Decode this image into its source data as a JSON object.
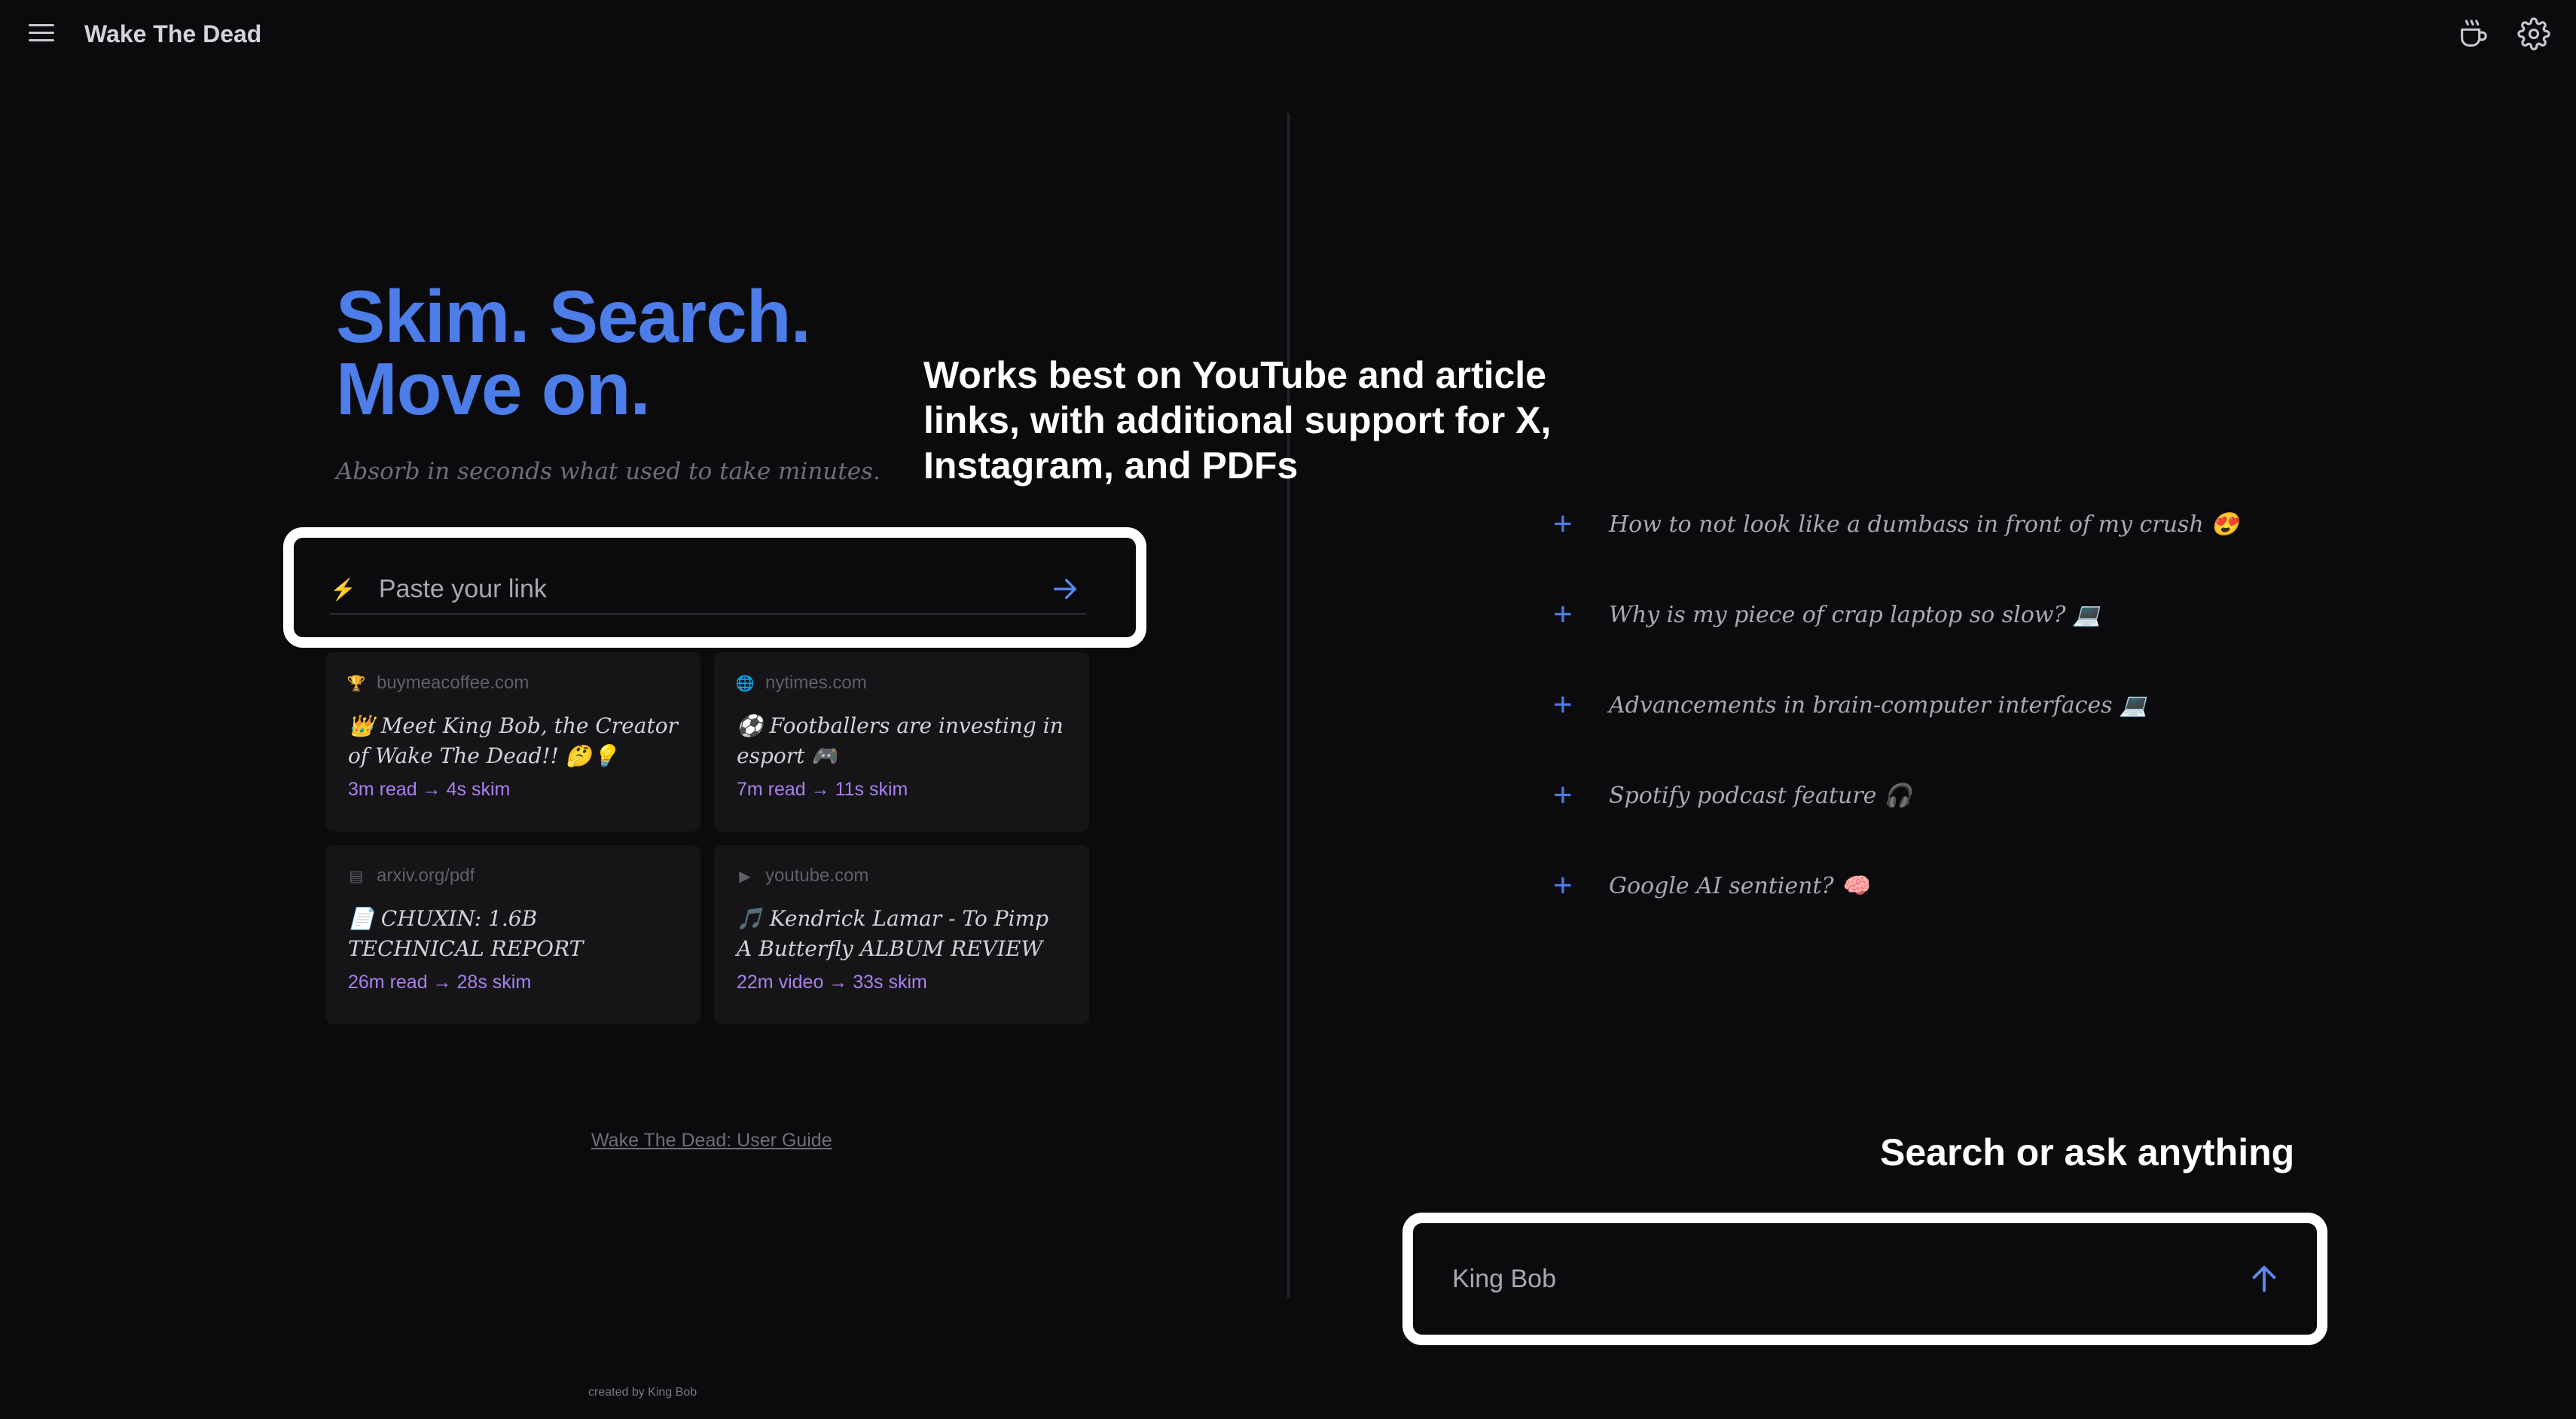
{
  "header": {
    "app_title": "Wake The Dead",
    "menu_icon": "hamburger-menu-icon",
    "coffee_icon": "coffee-cup-icon",
    "settings_icon": "gear-icon"
  },
  "hero": {
    "line1": "Skim. Search.",
    "line2": "Move on.",
    "tagline": "Absorb in seconds what used to take minutes.",
    "accent_color": "#4c7de8"
  },
  "annotations": {
    "left": "Works best on YouTube and article links, with additional support for X, Instagram, and PDFs",
    "right": "Search or ask anything"
  },
  "link_box": {
    "bolt": "⚡",
    "placeholder": "Paste your link",
    "value": ""
  },
  "cards": [
    {
      "source": "buymeacoffee.com",
      "source_icon": "🏆",
      "title": "👑 Meet King Bob, the Creator of Wake The Dead!! 🤔💡",
      "meta": "3m read → 4s skim"
    },
    {
      "source": "nytimes.com",
      "source_icon": "🌐",
      "title": "⚽ Footballers are investing in esport 🎮",
      "meta": "7m read → 11s skim"
    },
    {
      "source": "arxiv.org/pdf",
      "source_icon": "▤",
      "title": "📄 CHUXIN: 1.6B TECHNICAL REPORT",
      "meta": "26m read → 28s skim"
    },
    {
      "source": "youtube.com",
      "source_icon": "▶",
      "title": "🎵 Kendrick Lamar - To Pimp A Butterfly ALBUM REVIEW",
      "meta": "22m video → 33s skim"
    }
  ],
  "guide_link": "Wake The Dead: User Guide",
  "credit": "created by King Bob",
  "suggestions": [
    {
      "icon": "+",
      "text": "How to not look like a dumbass in front of my crush 😍"
    },
    {
      "icon": "+",
      "text": "Why is my piece of crap laptop so slow? 💻"
    },
    {
      "icon": "+",
      "text": "Advancements in brain-computer interfaces 💻"
    },
    {
      "icon": "+",
      "text": "Spotify podcast feature 🎧"
    },
    {
      "icon": "+",
      "text": "Google AI sentient? 🧠"
    }
  ],
  "search_box": {
    "value": "King Bob"
  }
}
